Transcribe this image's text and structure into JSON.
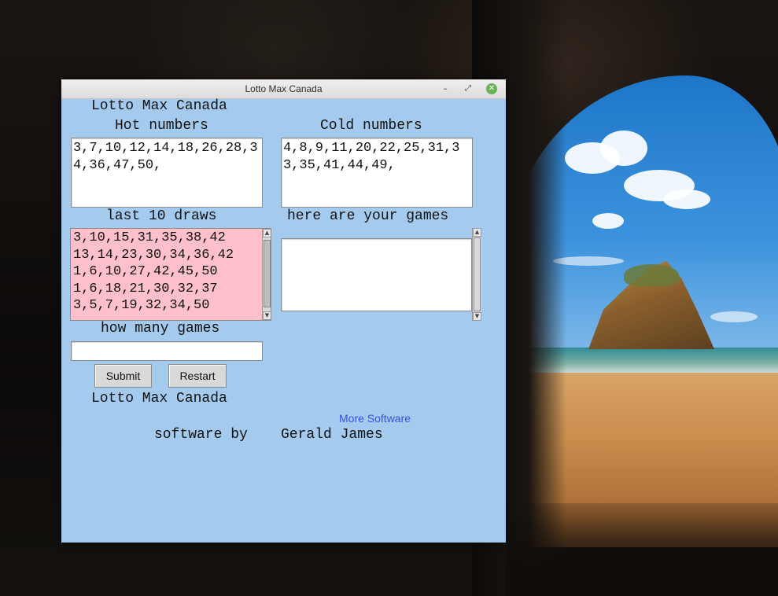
{
  "window": {
    "title": "Lotto Max Canada"
  },
  "heading": "Lotto Max Canada",
  "hot": {
    "label": "Hot numbers",
    "value": "3,7,10,12,14,18,26,28,34,36,47,50,"
  },
  "cold": {
    "label": "Cold numbers",
    "value": "4,8,9,11,20,22,25,31,33,35,41,44,49,"
  },
  "draws": {
    "label": "last 10 draws",
    "lines": [
      "3,10,15,31,35,38,42",
      "13,14,23,30,34,36,42",
      "1,6,10,27,42,45,50",
      "1,6,18,21,30,32,37",
      "3,5,7,19,32,34,50"
    ]
  },
  "games": {
    "label": "here are your games",
    "value": ""
  },
  "how_many": {
    "label": "how many games",
    "value": ""
  },
  "buttons": {
    "submit": "Submit",
    "restart": "Restart"
  },
  "footer": {
    "title": "Lotto Max Canada",
    "more_link": "More Software",
    "credit_prefix": "software by",
    "credit_name": "Gerald James"
  },
  "colors": {
    "window_bg": "#a4cbee",
    "draws_bg": "#ffc0cb",
    "link": "#3b4ee6"
  }
}
